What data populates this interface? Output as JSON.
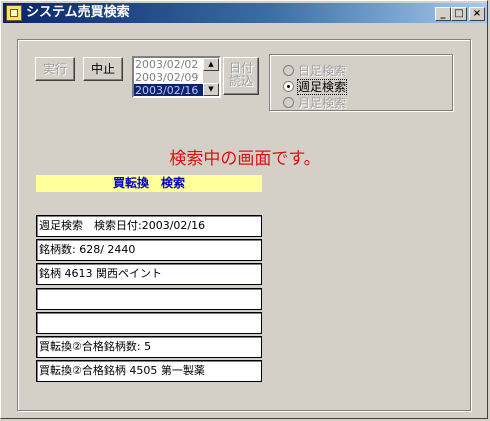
{
  "window": {
    "title": "システム売買検索",
    "controls": {
      "minimize": "_",
      "maximize": "□",
      "close": "×"
    }
  },
  "toolbar": {
    "run_label": "実行",
    "stop_label": "中止",
    "date_read_label_line1": "日付",
    "date_read_label_line2": "読込"
  },
  "date_list": {
    "items": [
      "2003/02/02",
      "2003/02/09",
      "2003/02/16"
    ],
    "selected": "2003/02/16",
    "scroll_up": "▲",
    "scroll_down": "▼"
  },
  "search_type": {
    "options": [
      {
        "label": "日足検索",
        "selected": false,
        "enabled": false
      },
      {
        "label": "週足検索",
        "selected": true,
        "enabled": true
      },
      {
        "label": "月足検索",
        "selected": false,
        "enabled": false
      }
    ]
  },
  "status_message": "検索中の画面です。",
  "section_header": "買転換　検索",
  "info_fields": [
    "週足検索　検索日付:2003/02/16",
    "銘柄数: 628/ 2440",
    "銘柄 4613 関西ペイント",
    "",
    "",
    "買転換②合格銘柄数: 5",
    "買転換②合格銘柄 4505 第一製薬"
  ],
  "colors": {
    "status_text": "#e01010",
    "header_band_bg": "#ffff99",
    "header_band_text": "#0000cc",
    "title_bar": "#0a246a"
  }
}
